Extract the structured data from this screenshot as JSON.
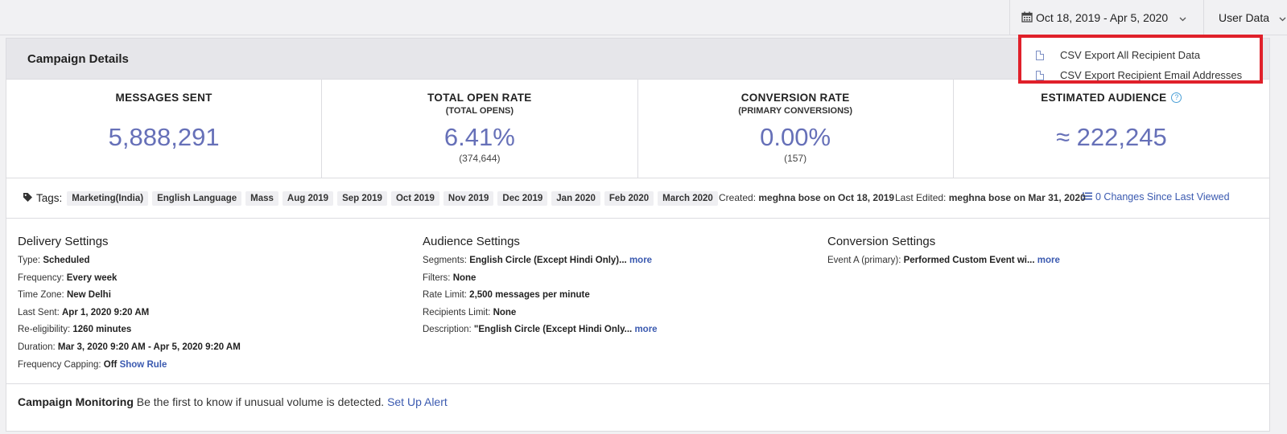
{
  "topbar": {
    "date_range": "Oct 18, 2019 - Apr 5, 2020",
    "user_data_label": "User Data"
  },
  "dropdown": {
    "items": [
      "CSV Export All Recipient Data",
      "CSV Export Recipient Email Addresses"
    ]
  },
  "card": {
    "title": "Campaign Details"
  },
  "stats": [
    {
      "title": "MESSAGES SENT",
      "subtitle": "",
      "value": "5,888,291",
      "detail": ""
    },
    {
      "title": "TOTAL OPEN RATE",
      "subtitle": "(TOTAL OPENS)",
      "value": "6.41%",
      "detail": "(374,644)"
    },
    {
      "title": "CONVERSION RATE",
      "subtitle": "(PRIMARY CONVERSIONS)",
      "value": "0.00%",
      "detail": "(157)"
    },
    {
      "title": "ESTIMATED AUDIENCE",
      "subtitle": "",
      "value": "≈ 222,245",
      "detail": ""
    }
  ],
  "tags": {
    "label": "Tags:",
    "items": [
      "Marketing(India)",
      "English Language",
      "Mass",
      "Aug 2019",
      "Sep 2019",
      "Oct 2019",
      "Nov 2019",
      "Dec 2019",
      "Jan 2020",
      "Feb 2020",
      "March 2020"
    ]
  },
  "meta": {
    "created_label": "Created:",
    "created_value": "meghna bose on Oct 18, 2019",
    "edited_label": "Last Edited:",
    "edited_value": "meghna bose on Mar 31, 2020",
    "changes_link": "0 Changes Since Last Viewed"
  },
  "delivery": {
    "title": "Delivery Settings",
    "rows": [
      {
        "label": "Type:",
        "value": "Scheduled"
      },
      {
        "label": "Frequency:",
        "value": "Every week"
      },
      {
        "label": "Time Zone:",
        "value": "New Delhi"
      },
      {
        "label": "Last Sent:",
        "value": "Apr 1, 2020 9:20 AM"
      },
      {
        "label": "Re-eligibility:",
        "value": "1260 minutes"
      },
      {
        "label": "Duration:",
        "value": "Mar 3, 2020 9:20 AM - Apr 5, 2020 9:20 AM"
      },
      {
        "label": "Frequency Capping:",
        "value": "Off",
        "link": "Show Rule"
      }
    ]
  },
  "audience": {
    "title": "Audience Settings",
    "rows": [
      {
        "label": "Segments:",
        "value": "English Circle (Except Hindi Only)...",
        "link": "more"
      },
      {
        "label": "Filters:",
        "value": "None"
      },
      {
        "label": "Rate Limit:",
        "value": "2,500 messages per minute"
      },
      {
        "label": "Recipients Limit:",
        "value": "None"
      },
      {
        "label": "Description:",
        "value": "\"English Circle (Except Hindi Only...",
        "link": "more"
      }
    ]
  },
  "conversion": {
    "title": "Conversion Settings",
    "rows": [
      {
        "label": "Event A (primary):",
        "value": "Performed Custom Event wi...",
        "link": "more"
      }
    ]
  },
  "monitoring": {
    "title": "Campaign Monitoring",
    "text": "Be the first to know if unusual volume is detected.",
    "link": "Set Up Alert"
  }
}
